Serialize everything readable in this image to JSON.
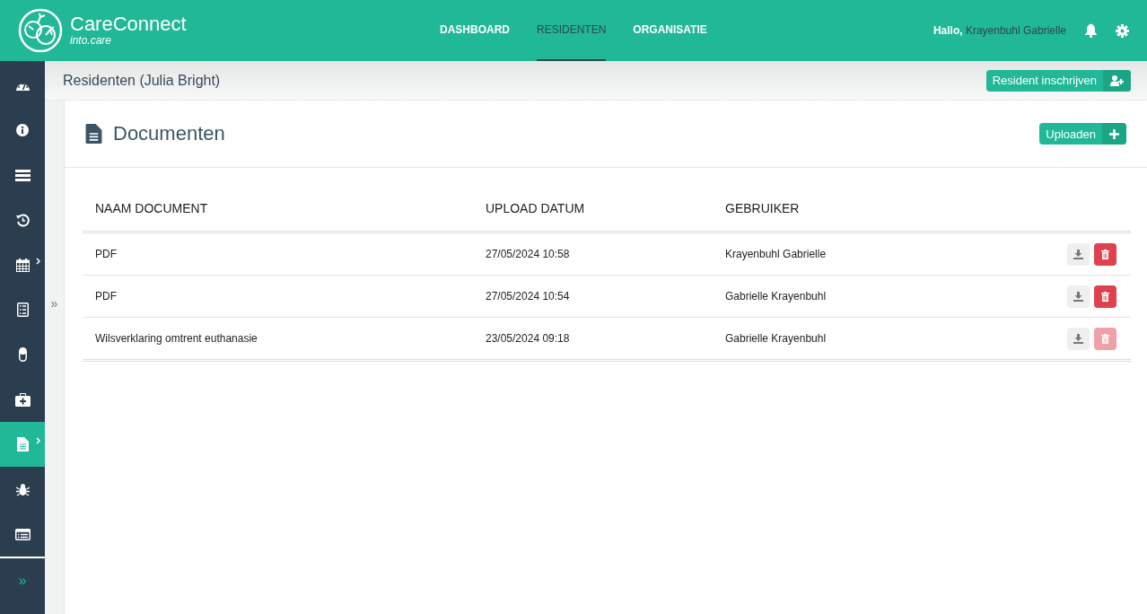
{
  "brand": {
    "name": "CareConnect",
    "tagline": "into.care"
  },
  "nav": [
    {
      "label": "DASHBOARD",
      "selected": false
    },
    {
      "label": "RESIDENTEN",
      "selected": true
    },
    {
      "label": "ORGANISATIE",
      "selected": false
    }
  ],
  "user": {
    "greeting": "Hallo,",
    "name": "Krayenbuhl Gabrielle"
  },
  "sidebar": {
    "items": [
      {
        "selected": false,
        "submenu": false
      },
      {
        "selected": false,
        "submenu": false
      },
      {
        "selected": false,
        "submenu": false
      },
      {
        "selected": false,
        "submenu": false
      },
      {
        "selected": false,
        "submenu": true
      },
      {
        "selected": false,
        "submenu": false
      },
      {
        "selected": false,
        "submenu": false
      },
      {
        "selected": false,
        "submenu": false
      },
      {
        "selected": true,
        "submenu": true
      },
      {
        "selected": false,
        "submenu": false
      },
      {
        "selected": false,
        "submenu": false
      }
    ],
    "expand": "»"
  },
  "collapse_toggle": "»",
  "page": {
    "title": "Residenten (Julia Bright)",
    "action": "Resident inschrijven"
  },
  "section": {
    "title": "Documenten",
    "action": "Uploaden"
  },
  "table": {
    "columns": [
      "NAAM DOCUMENT",
      "UPLOAD DATUM",
      "GEBRUIKER"
    ],
    "rows": [
      {
        "name": "PDF",
        "date": "27/05/2024 10:58",
        "user": "Krayenbuhl Gabrielle",
        "delete_disabled": false
      },
      {
        "name": "PDF",
        "date": "27/05/2024 10:54",
        "user": "Gabrielle Krayenbuhl",
        "delete_disabled": false
      },
      {
        "name": "Wilsverklaring omtrent euthanasie",
        "date": "23/05/2024 09:18",
        "user": "Gabrielle Krayenbuhl",
        "delete_disabled": true
      }
    ]
  }
}
